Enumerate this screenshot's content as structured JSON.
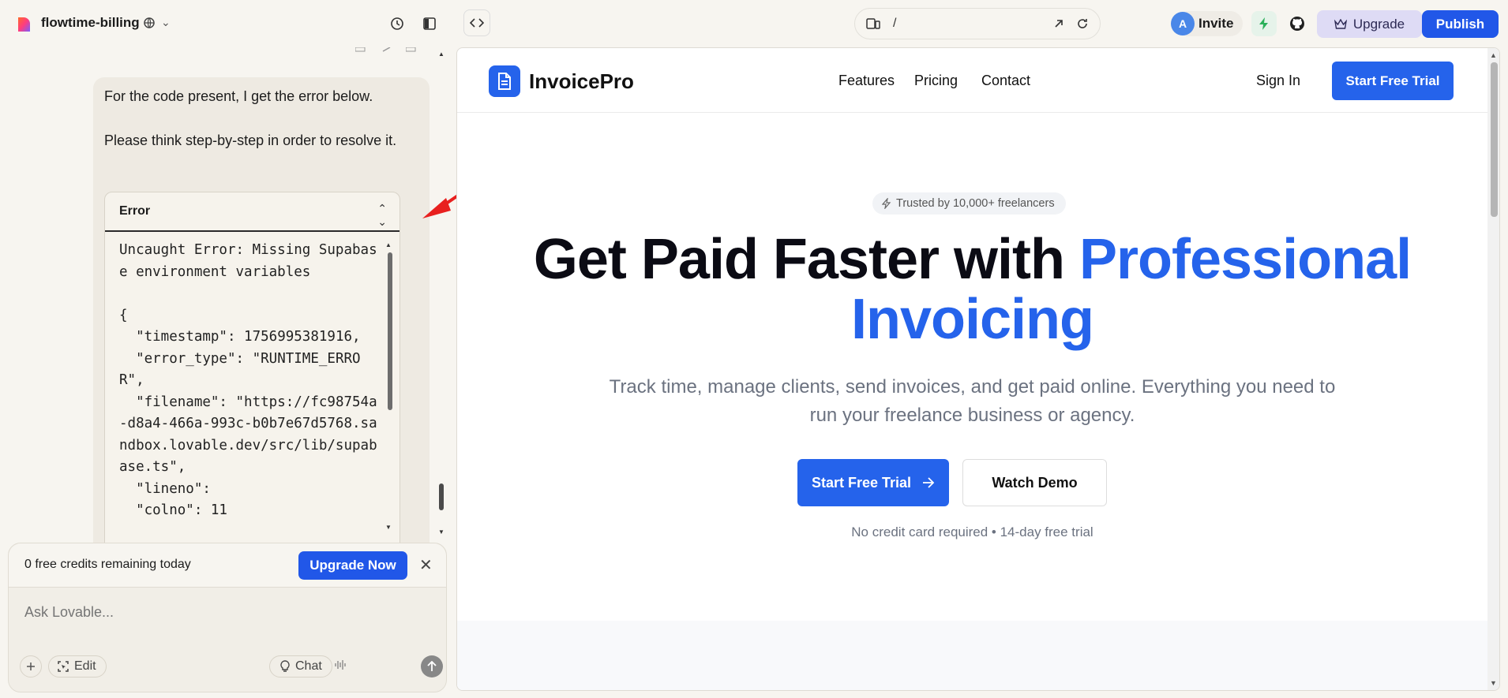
{
  "topbar": {
    "project_name": "flowtime-billing",
    "url_path": "/",
    "avatar_initial": "A",
    "invite_label": "Invite",
    "upgrade_label": "Upgrade",
    "publish_label": "Publish"
  },
  "chat": {
    "message_line1": "For the code present, I get the error below.",
    "message_line2": "Please think step-by-step in order to resolve it.",
    "error_title": "Error",
    "error_text": "Uncaught Error: Missing Supabase environment variables\n\n{\n  \"timestamp\": 1756995381916,\n  \"error_type\": \"RUNTIME_ERROR\",\n  \"filename\": \"https://fc98754a-d8a4-466a-993c-b0b7e67d5768.sandbox.lovable.dev/src/lib/supabase.ts\",\n  \"lineno\":\n  \"colno\": 11",
    "credits_text": "0 free credits remaining today",
    "upgrade_now_label": "Upgrade Now",
    "input_placeholder": "Ask Lovable...",
    "edit_label": "Edit",
    "chat_label": "Chat"
  },
  "preview": {
    "brand": "InvoicePro",
    "nav_links": [
      "Features",
      "Pricing",
      "Contact"
    ],
    "sign_in": "Sign In",
    "trial_button": "Start Free Trial",
    "trust_badge": "Trusted by 10,000+ freelancers",
    "hero_title_dark": "Get Paid Faster with",
    "hero_title_blue": "Professional Invoicing",
    "hero_subtitle": "Track time, manage clients, send invoices, and get paid online. Everything you need to run your freelance business or agency.",
    "cta_primary": "Start Free Trial",
    "cta_secondary": "Watch Demo",
    "hero_note": "No credit card required • 14-day free trial"
  },
  "colors": {
    "accent": "#2157e8",
    "preview_blue": "#2563eb",
    "annotation_red": "#e8201f"
  }
}
